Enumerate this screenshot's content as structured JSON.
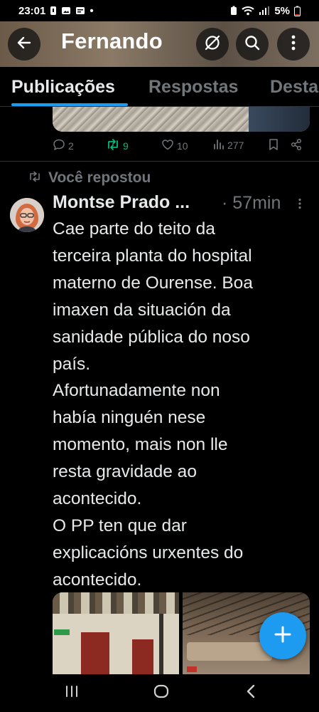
{
  "status_bar": {
    "time": "23:01",
    "battery": "5%",
    "dot": "•",
    "icons": [
      "notification-icon",
      "gallery-icon",
      "alarm-icon",
      "wifi-icon",
      "signal-icon",
      "battery-icon"
    ]
  },
  "header": {
    "title": "Fernando",
    "back_icon": "arrow-left-icon",
    "buttons": [
      "unfollow-icon",
      "search-icon",
      "more-vertical-icon"
    ]
  },
  "tabs": [
    {
      "label": "Publicações",
      "active": true
    },
    {
      "label": "Respostas",
      "active": false
    },
    {
      "label": "Desta",
      "active": false
    }
  ],
  "previous_post": {
    "replies": "2",
    "reposts": "9",
    "likes": "10",
    "views": "277"
  },
  "repost_label": "Você repostou",
  "tweet": {
    "author": "Montse Prado ...",
    "time": "· 57min",
    "text": "Cae parte do teito da\nterceira planta do hospital\nmaterno de Ourense. Boa\nimaxen da situación da\nsanidade pública do noso\npaís.\nAfortunadamente non\nhabía ninguén nese\nmomento, mais non lle\nresta gravidade ao\nacontecido.\nO PP ten que dar\nexplicacións urxentes do\nacontecido."
  },
  "fab": {
    "icon": "plus-icon"
  },
  "nav_bar": [
    "recent-apps-icon",
    "home-icon",
    "back-icon"
  ],
  "colors": {
    "accent": "#1d9bf0",
    "repost_green": "#00ba7c",
    "secondary_text": "#71767b",
    "primary_text": "#e7e9ea"
  }
}
